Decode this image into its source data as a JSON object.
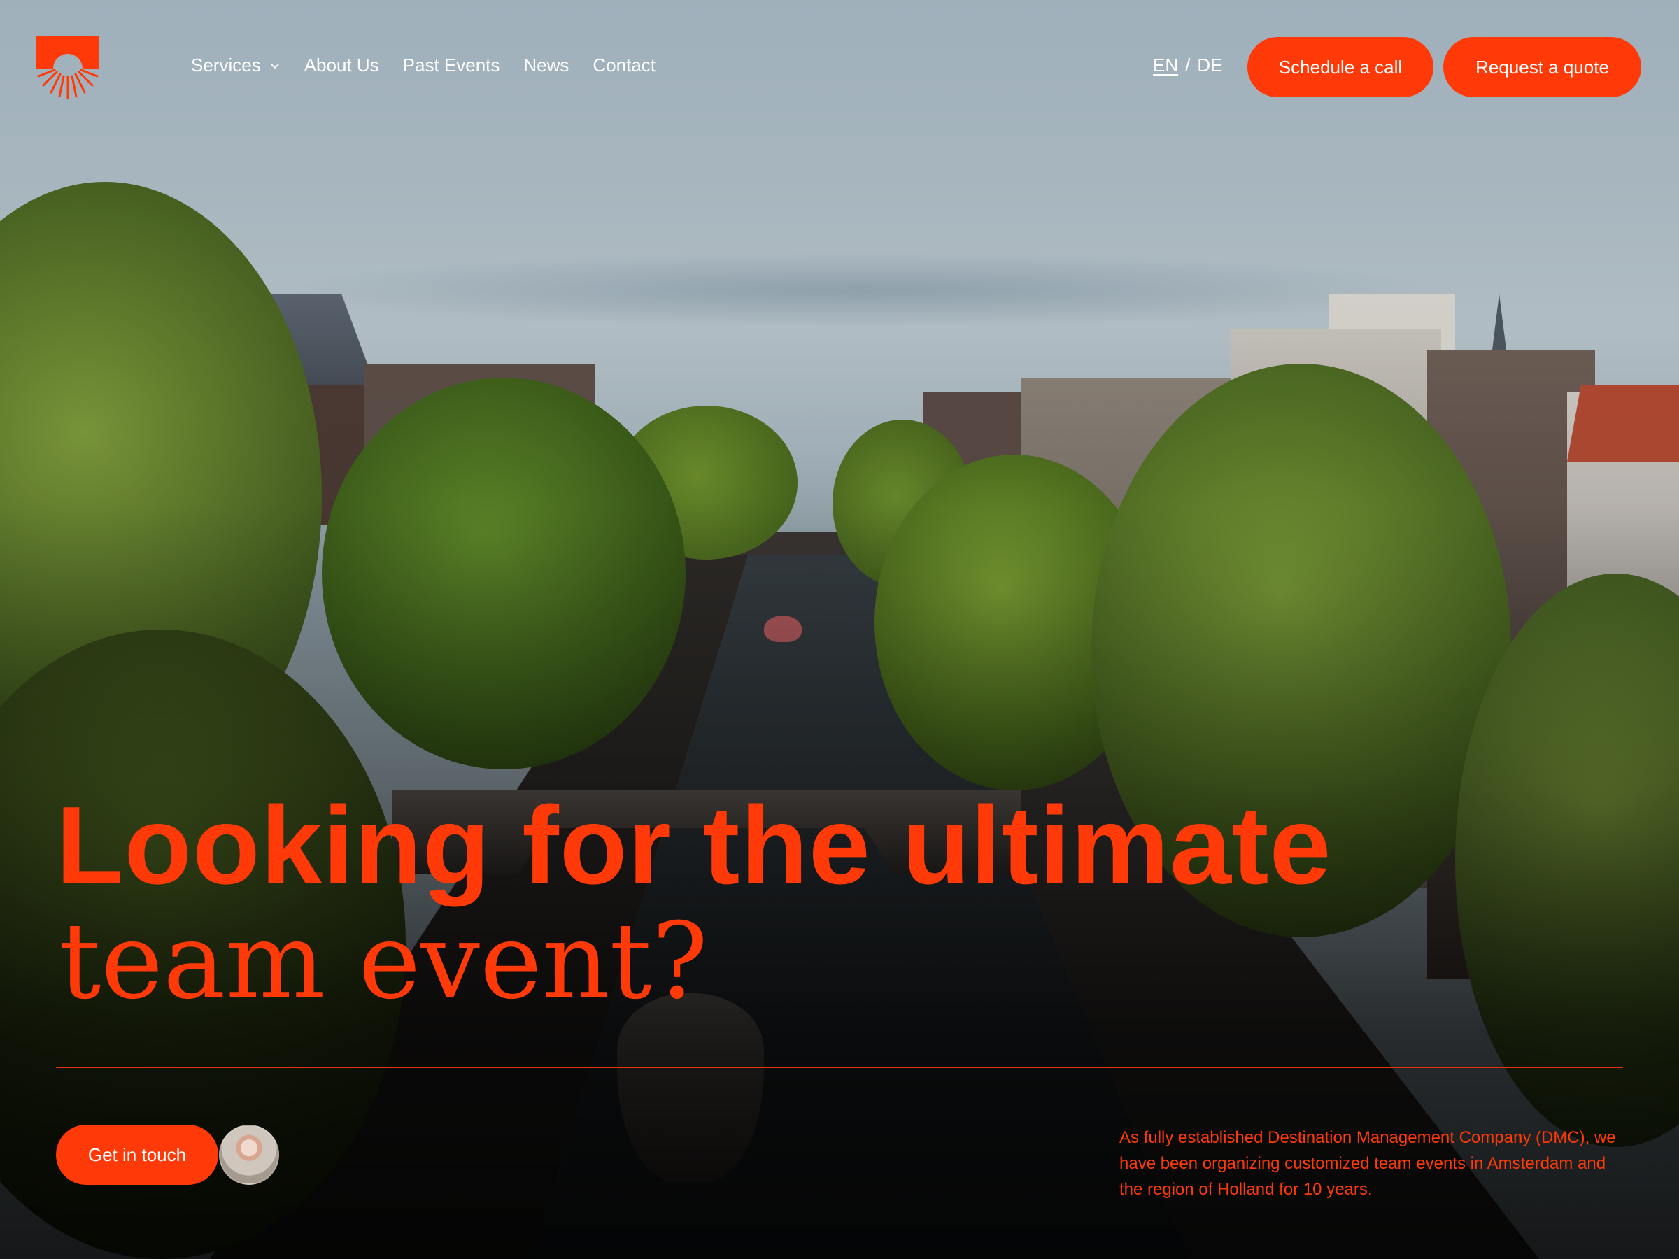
{
  "nav": {
    "items": [
      {
        "label": "Services",
        "has_dropdown": true
      },
      {
        "label": "About Us"
      },
      {
        "label": "Past Events"
      },
      {
        "label": "News"
      },
      {
        "label": "Contact"
      }
    ]
  },
  "language": {
    "en": "EN",
    "separator": "/",
    "de": "DE",
    "active": "EN"
  },
  "buttons": {
    "schedule": "Schedule a call",
    "quote": "Request a quote",
    "get_in_touch": "Get in touch"
  },
  "hero": {
    "line1": "Looking for the ultimate",
    "line2": "team event?"
  },
  "intro_text": "As fully established Destination Management Company (DMC), we have been organizing customized team events in Amsterdam and the region of Holland for 10 years.",
  "colors": {
    "accent": "#ff3a08",
    "nav_text": "#ffffff"
  },
  "icons": {
    "logo": "sunrise-logo-icon",
    "dropdown": "chevron-down-icon"
  }
}
